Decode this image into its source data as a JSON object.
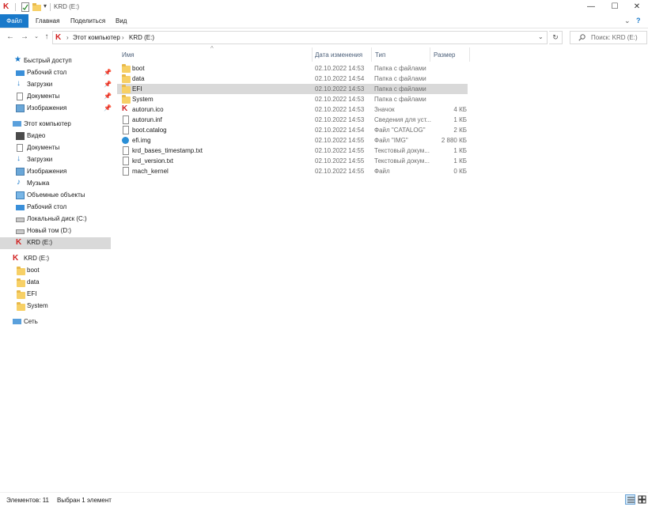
{
  "window": {
    "title": "KRD (E:)"
  },
  "ribbon": {
    "tabs": [
      "Файл",
      "Главная",
      "Поделиться",
      "Вид"
    ]
  },
  "address": {
    "path": [
      "Этот компьютер",
      "KRD (E:)"
    ],
    "search_placeholder": "Поиск: KRD (E:)"
  },
  "nav": {
    "quick_access": "Быстрый доступ",
    "quick_items": [
      "Рабочий стол",
      "Загрузки",
      "Документы",
      "Изображения"
    ],
    "this_pc": "Этот компьютер",
    "pc_items": [
      "Видео",
      "Документы",
      "Загрузки",
      "Изображения",
      "Музыка",
      "Объемные объекты",
      "Рабочий стол",
      "Локальный диск (C:)",
      "Новый том (D:)",
      "KRD (E:)"
    ],
    "drive": "KRD (E:)",
    "drive_items": [
      "boot",
      "data",
      "EFI",
      "System"
    ],
    "network": "Сеть"
  },
  "columns": {
    "name": "Имя",
    "date": "Дата изменения",
    "type": "Тип",
    "size": "Размер"
  },
  "files": [
    {
      "name": "boot",
      "date": "02.10.2022 14:53",
      "type": "Папка с файлами",
      "size": "",
      "icon": "folder"
    },
    {
      "name": "data",
      "date": "02.10.2022 14:54",
      "type": "Папка с файлами",
      "size": "",
      "icon": "folder"
    },
    {
      "name": "EFI",
      "date": "02.10.2022 14:53",
      "type": "Папка с файлами",
      "size": "",
      "icon": "folder"
    },
    {
      "name": "System",
      "date": "02.10.2022 14:53",
      "type": "Папка с файлами",
      "size": "",
      "icon": "folder"
    },
    {
      "name": "autorun.ico",
      "date": "02.10.2022 14:53",
      "type": "Значок",
      "size": "4 КБ",
      "icon": "krd"
    },
    {
      "name": "autorun.inf",
      "date": "02.10.2022 14:53",
      "type": "Сведения для уст...",
      "size": "1 КБ",
      "icon": "inf"
    },
    {
      "name": "boot.catalog",
      "date": "02.10.2022 14:54",
      "type": "Файл \"CATALOG\"",
      "size": "2 КБ",
      "icon": "doc"
    },
    {
      "name": "efi.img",
      "date": "02.10.2022 14:55",
      "type": "Файл \"IMG\"",
      "size": "2 880 КБ",
      "icon": "img"
    },
    {
      "name": "krd_bases_timestamp.txt",
      "date": "02.10.2022 14:55",
      "type": "Текстовый докум...",
      "size": "1 КБ",
      "icon": "txt"
    },
    {
      "name": "krd_version.txt",
      "date": "02.10.2022 14:55",
      "type": "Текстовый докум...",
      "size": "1 КБ",
      "icon": "txt"
    },
    {
      "name": "mach_kernel",
      "date": "02.10.2022 14:55",
      "type": "Файл",
      "size": "0 КБ",
      "icon": "doc"
    }
  ],
  "status": {
    "count": "Элементов: 11",
    "selected": "Выбран 1 элемент"
  },
  "colors": {
    "accent": "#1979ca",
    "selection": "#d9d9d9",
    "folder": "#f7d066"
  }
}
